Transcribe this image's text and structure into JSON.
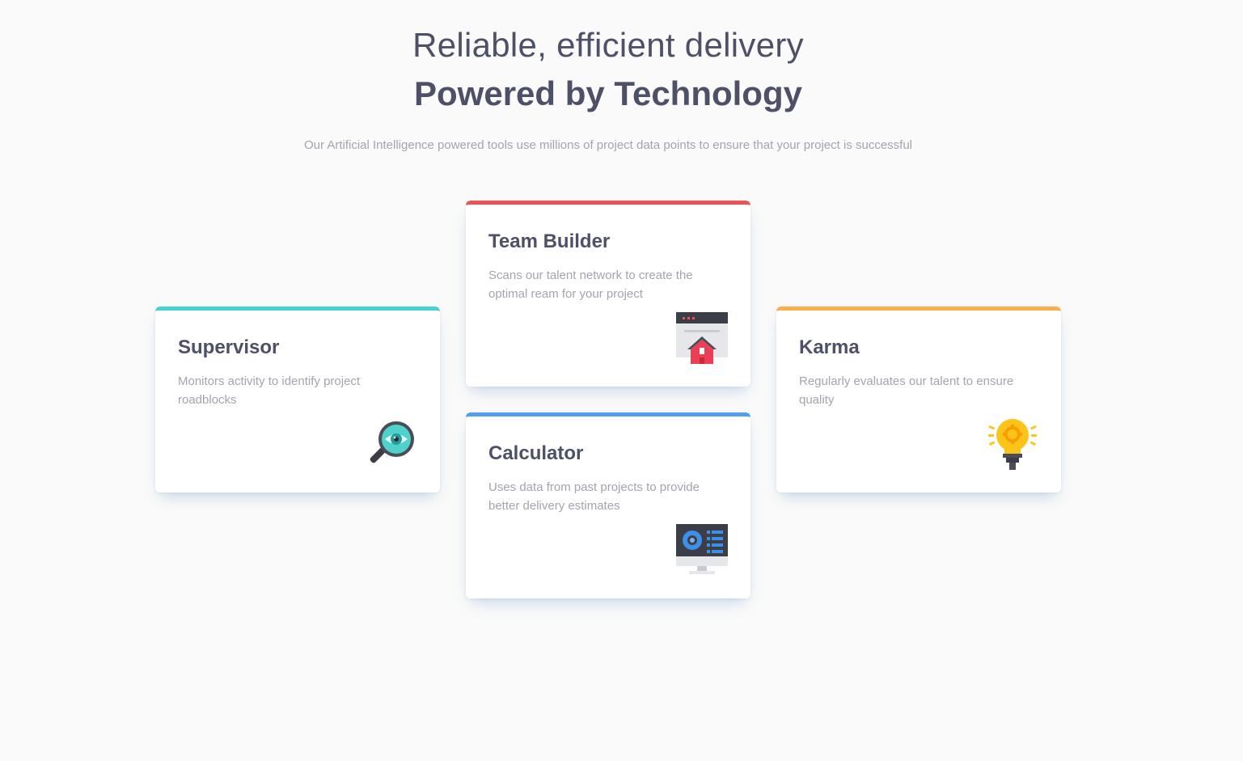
{
  "header": {
    "line1": "Reliable, efficient delivery",
    "line2": "Powered by Technology",
    "description": "Our Artificial Intelligence powered tools use millions of project data points to ensure that your project is successful"
  },
  "cards": {
    "supervisor": {
      "title": "Supervisor",
      "description": "Monitors activity to identify project roadblocks",
      "accent": "#44d3d2",
      "icon": "magnifier-eye-icon"
    },
    "team_builder": {
      "title": "Team Builder",
      "description": "Scans our talent network to create the optimal ream for your project",
      "accent": "#ea5454",
      "icon": "browser-home-icon"
    },
    "calculator": {
      "title": "Calculator",
      "description": "Uses data from past projects to provide better delivery estimates",
      "accent": "#549ef2",
      "icon": "monitor-dashboard-icon"
    },
    "karma": {
      "title": "Karma",
      "description": "Regularly evaluates our talent to ensure quality",
      "accent": "#fcae4a",
      "icon": "lightbulb-icon"
    }
  }
}
